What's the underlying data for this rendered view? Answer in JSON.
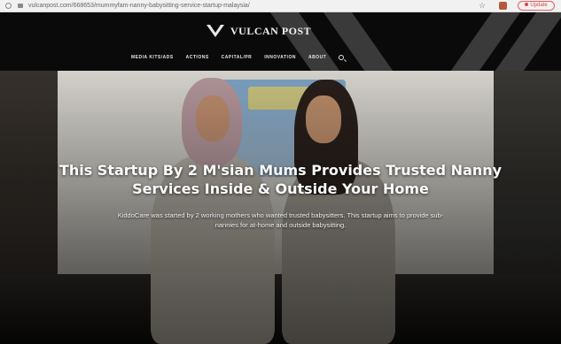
{
  "browser": {
    "url": "vulcanpost.com/668653/mummyfam-nanny-babysitting-service-startup-malaysia/",
    "update_label": "Update"
  },
  "site": {
    "logo_text": "VULCAN POST",
    "nav": [
      "MEDIA KITS/ADS",
      "ACTIONS",
      "CAPITAL/PR",
      "INNOVATION",
      "ABOUT"
    ]
  },
  "article": {
    "headline": "This Startup By 2 M'sian Mums Provides Trusted Nanny Services Inside & Outside Your Home",
    "subhead": "KiddoCare was started by 2 working mothers who wanted trusted babysitters. This startup aims to provide sub-nannies for at-home and outside babysitting."
  },
  "colors": {
    "header_bg": "#0a0a0a",
    "accent_red": "#d44444"
  },
  "icons": [
    "info-icon",
    "lock-icon",
    "star-icon",
    "extension-icon",
    "search-icon",
    "vulcan-logo-icon"
  ]
}
